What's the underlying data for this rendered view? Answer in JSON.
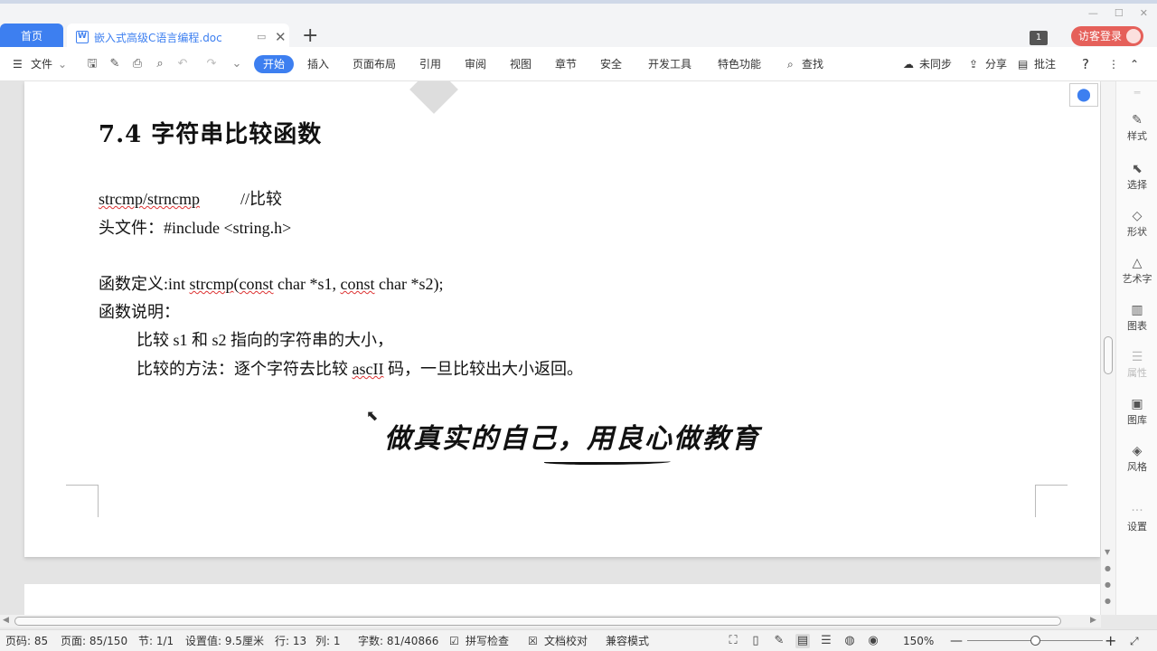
{
  "tabs": {
    "home": "首页",
    "doc": "嵌入式高级C语言编程.doc",
    "doc_icon": "W",
    "add": "+"
  },
  "window": {
    "badge": "1",
    "login": "访客登录"
  },
  "ribbon": {
    "file": "文件",
    "items": [
      "开始",
      "插入",
      "页面布局",
      "引用",
      "审阅",
      "视图",
      "章节",
      "安全",
      "开发工具",
      "特色功能"
    ],
    "find": "查找",
    "sync": "未同步",
    "share": "分享",
    "comment": "批注",
    "help": "?"
  },
  "doc": {
    "heading": "7.4  字符串比较函数",
    "line1_a": "strcmp/strncmp",
    "line1_b": "//比较",
    "line2": "头文件：#include <string.h>",
    "line3_a": "函数定义:int ",
    "line3_b": "strcmp",
    "line3_c": "(",
    "line3_d": "const",
    "line3_e": " char *s1, ",
    "line3_f": "const",
    "line3_g": " char *s2);",
    "line4": "函数说明：",
    "line5": "比较 s1 和 s2 指向的字符串的大小，",
    "line6_a": "比较的方法：逐个字符去比较 ",
    "line6_b": "ascII",
    "line6_c": " 码，一旦比较出大小返回。",
    "slogan": "做真实的自己，用良心做教育"
  },
  "sidepanel": {
    "items": [
      "样式",
      "选择",
      "形状",
      "艺术字",
      "图表",
      "属性",
      "图库",
      "风格",
      "设置"
    ]
  },
  "status": {
    "page_code": "页码: 85",
    "page": "页面: 85/150",
    "section": "节: 1/1",
    "setting": "设置值: 9.5厘米",
    "row": "行: 13",
    "col": "列: 1",
    "words": "字数: 81/40866",
    "spell": "拼写检查",
    "proof": "文档校对",
    "compat": "兼容模式",
    "zoom": "150%",
    "zoom_level": 0.5
  }
}
